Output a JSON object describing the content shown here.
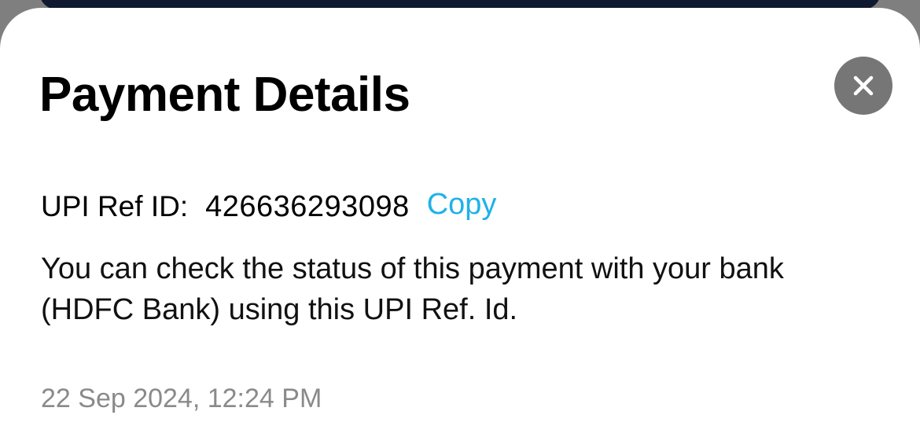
{
  "payment_details": {
    "title": "Payment Details",
    "close_icon": "close-icon",
    "upi_ref": {
      "label": "UPI Ref ID:",
      "value": "426636293098",
      "copy_label": "Copy"
    },
    "info_text": "You can check the status of this payment with your bank (HDFC Bank) using this UPI Ref. Id.",
    "timestamp": "22 Sep 2024, 12:24 PM"
  },
  "colors": {
    "accent": "#1fb2e8",
    "close_button_bg": "#767676",
    "timestamp_text": "#8a8a8a",
    "backdrop": "#7f7f7f",
    "card_behind": "#0f1a30"
  }
}
